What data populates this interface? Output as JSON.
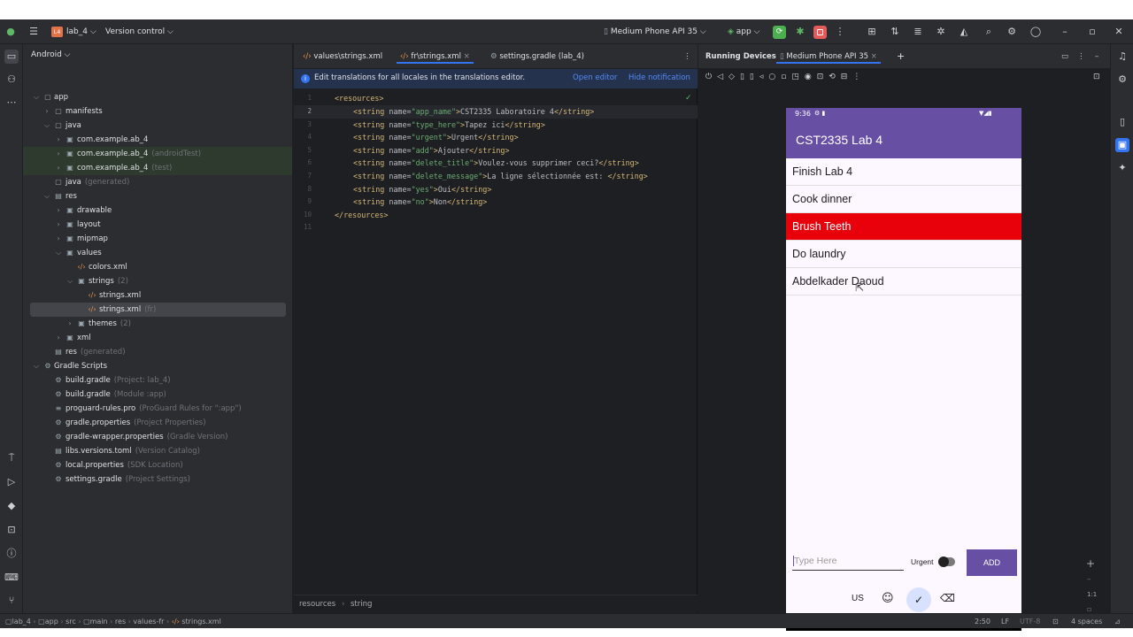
{
  "titlebar": {
    "project_badge": "L4",
    "project_name": "lab_4",
    "vcs": "Version control",
    "device": "Medium Phone API 35",
    "run_config": "app"
  },
  "project_panel": {
    "view": "Android",
    "items": [
      {
        "label": "app",
        "hint": ""
      },
      {
        "label": "manifests",
        "hint": ""
      },
      {
        "label": "java",
        "hint": ""
      },
      {
        "label": "com.example.ab_4",
        "hint": ""
      },
      {
        "label": "com.example.ab_4",
        "hint": "(androidTest)"
      },
      {
        "label": "com.example.ab_4",
        "hint": "(test)"
      },
      {
        "label": "java",
        "hint": "(generated)"
      },
      {
        "label": "res",
        "hint": ""
      },
      {
        "label": "drawable",
        "hint": ""
      },
      {
        "label": "layout",
        "hint": ""
      },
      {
        "label": "mipmap",
        "hint": ""
      },
      {
        "label": "values",
        "hint": ""
      },
      {
        "label": "colors.xml",
        "hint": ""
      },
      {
        "label": "strings",
        "hint": "(2)"
      },
      {
        "label": "strings.xml",
        "hint": ""
      },
      {
        "label": "strings.xml",
        "hint": "(fr)"
      },
      {
        "label": "themes",
        "hint": "(2)"
      },
      {
        "label": "xml",
        "hint": ""
      },
      {
        "label": "res",
        "hint": "(generated)"
      },
      {
        "label": "Gradle Scripts",
        "hint": ""
      },
      {
        "label": "build.gradle",
        "hint": "(Project: lab_4)"
      },
      {
        "label": "build.gradle",
        "hint": "(Module :app)"
      },
      {
        "label": "proguard-rules.pro",
        "hint": "(ProGuard Rules for \":app\")"
      },
      {
        "label": "gradle.properties",
        "hint": "(Project Properties)"
      },
      {
        "label": "gradle-wrapper.properties",
        "hint": "(Gradle Version)"
      },
      {
        "label": "libs.versions.toml",
        "hint": "(Version Catalog)"
      },
      {
        "label": "local.properties",
        "hint": "(SDK Location)"
      },
      {
        "label": "settings.gradle",
        "hint": "(Project Settings)"
      }
    ]
  },
  "editor": {
    "tabs": [
      "values\\strings.xml",
      "fr\\strings.xml",
      "settings.gradle (lab_4)"
    ],
    "notification": "Edit translations for all locales in the translations editor.",
    "open_editor": "Open editor",
    "hide_notification": "Hide notification",
    "line_numbers": [
      "1",
      "2",
      "3",
      "4",
      "5",
      "6",
      "7",
      "8",
      "9",
      "10",
      "11"
    ],
    "lines": [
      {
        "tag_open": "<resources>",
        "name": "",
        "value": "",
        "close": ""
      },
      {
        "tag_open": "<string ",
        "name": "app_name",
        "value": "CST2335 Laboratoire 4",
        "close": "</string>"
      },
      {
        "tag_open": "<string ",
        "name": "type_here",
        "value": "Tapez ici",
        "close": "</string>"
      },
      {
        "tag_open": "<string ",
        "name": "urgent",
        "value": "Urgent",
        "close": "</string>"
      },
      {
        "tag_open": "<string ",
        "name": "add",
        "value": "Ajouter",
        "close": "</string>"
      },
      {
        "tag_open": "<string ",
        "name": "delete_title",
        "value": "Voulez-vous supprimer ceci?",
        "close": "</string>"
      },
      {
        "tag_open": "<string ",
        "name": "delete_message",
        "value": "La ligne sélectionnée est: ",
        "close": "</string>"
      },
      {
        "tag_open": "<string ",
        "name": "yes",
        "value": "Oui",
        "close": "</string>"
      },
      {
        "tag_open": "<string ",
        "name": "no",
        "value": "Non",
        "close": "</string>"
      },
      {
        "tag_open": "</resources>",
        "name": "",
        "value": "",
        "close": ""
      }
    ],
    "breadcrumb": [
      "resources",
      "string"
    ]
  },
  "devices": {
    "tab_running": "Running Devices",
    "tab_device": "Medium Phone API 35",
    "phone": {
      "time": "9:36",
      "app_title": "CST2335 Lab 4",
      "items": [
        "Finish Lab 4",
        "Cook dinner",
        "Brush Teeth",
        "Do laundry",
        "Abdelkader Daoud"
      ],
      "urgent_index": 2,
      "input_placeholder": "Type Here",
      "urgent_label": "Urgent",
      "add_button": "ADD",
      "keyboard_lang": "US"
    },
    "zoom_label": "1:1"
  },
  "statusbar": {
    "path": [
      "lab_4",
      "app",
      "src",
      "main",
      "res",
      "values-fr",
      "strings.xml"
    ],
    "position": "2:50",
    "line_sep": "LF",
    "encoding": "UTF-8",
    "indent": "4 spaces"
  },
  "colors": {
    "accent_purple": "#6750a4",
    "urgent_red": "#e8000b",
    "green_run": "#4caf50",
    "red_stop": "#e55b5b"
  }
}
